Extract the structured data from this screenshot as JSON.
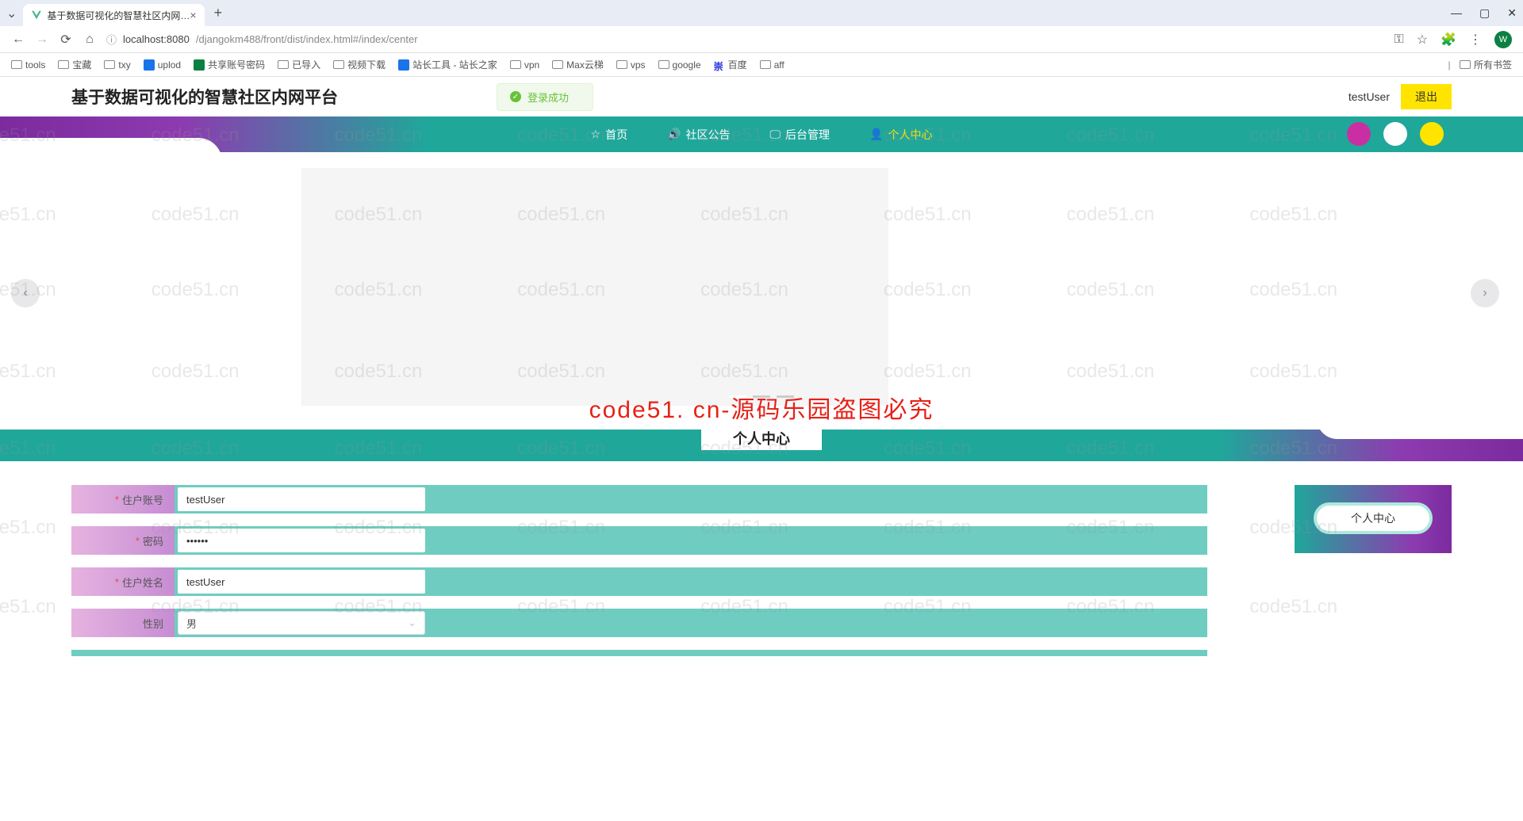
{
  "browser": {
    "tab_title": "基于数据可视化的智慧社区内网…",
    "url_host": "localhost:8080",
    "url_path": "/djangokm488/front/dist/index.html#/index/center",
    "bookmarks": [
      "tools",
      "宝藏",
      "txy",
      "uplod",
      "共享账号密码",
      "已导入",
      "视频下载",
      "站长工具 - 站长之家",
      "vpn",
      "Max云梯",
      "vps",
      "google",
      "百度",
      "aff"
    ],
    "all_bookmarks": "所有书签",
    "avatar_letter": "W"
  },
  "header": {
    "title": "基于数据可视化的智慧社区内网平台",
    "toast": "登录成功",
    "user": "testUser",
    "logout": "退出"
  },
  "nav": {
    "items": [
      {
        "icon": "☆",
        "label": "首页"
      },
      {
        "icon": "🔊",
        "label": "社区公告"
      },
      {
        "icon": "🖵",
        "label": "后台管理"
      },
      {
        "icon": "👤",
        "label": "个人中心",
        "active": true
      }
    ],
    "dot_colors": [
      "#c92fa3",
      "#ffffff",
      "#ffe400"
    ]
  },
  "section": {
    "title": "个人中心"
  },
  "form": {
    "fields": [
      {
        "label": "住户账号",
        "required": true,
        "type": "text",
        "value": "testUser"
      },
      {
        "label": "密码",
        "required": true,
        "type": "password",
        "value": "••••••"
      },
      {
        "label": "住户姓名",
        "required": true,
        "type": "text",
        "value": "testUser"
      },
      {
        "label": "性别",
        "required": false,
        "type": "select",
        "value": "男"
      }
    ]
  },
  "side": {
    "button": "个人中心"
  },
  "watermark": {
    "text": "code51.cn",
    "center": "code51. cn-源码乐园盗图必究"
  }
}
